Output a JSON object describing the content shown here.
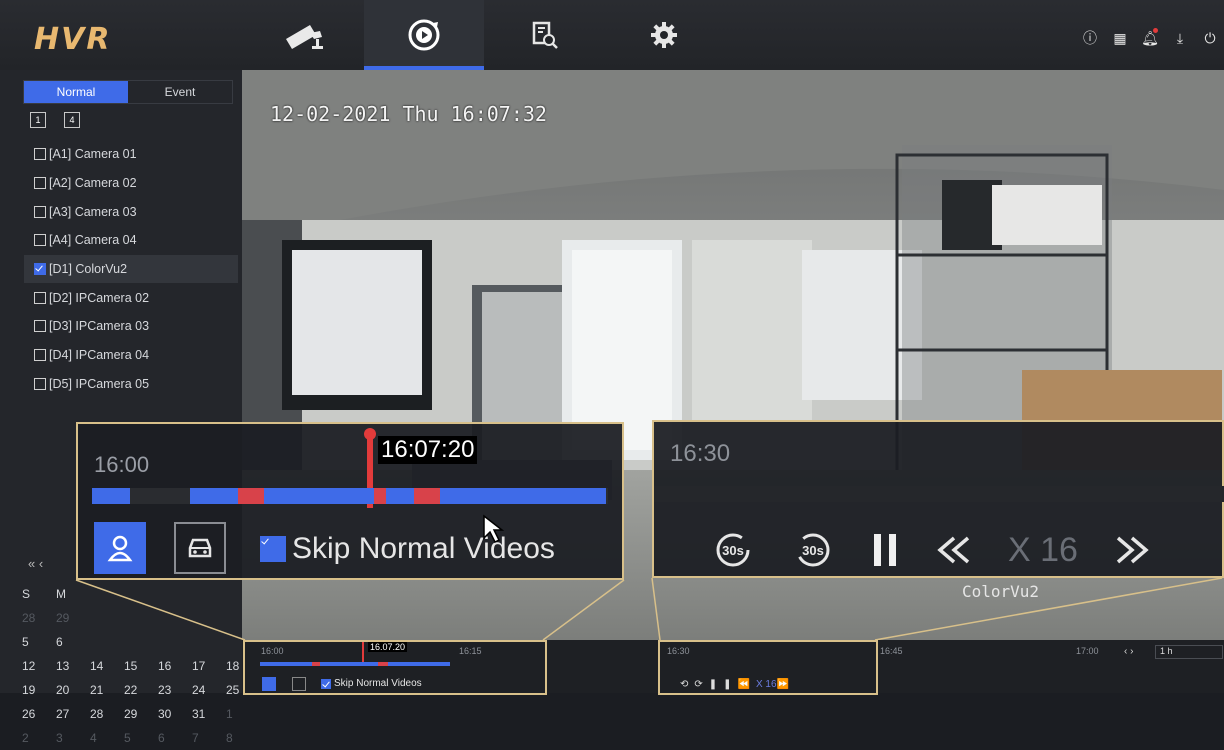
{
  "app": {
    "logo": "HVR"
  },
  "nav": {
    "tabs": [
      {
        "name": "live-view",
        "icon": "camera-icon",
        "active": false
      },
      {
        "name": "playback",
        "icon": "playback-icon",
        "active": true
      },
      {
        "name": "search",
        "icon": "file-search-icon",
        "active": false
      },
      {
        "name": "configuration",
        "icon": "gear-icon",
        "active": false
      }
    ]
  },
  "topright_icons": [
    "info-icon",
    "qr-icon",
    "bell-icon",
    "download-icon",
    "power-icon"
  ],
  "sidebar": {
    "mode_tabs": [
      "Normal",
      "Event"
    ],
    "active_mode": "Normal",
    "layouts": [
      "1",
      "4"
    ],
    "cameras": [
      {
        "label": "[A1] Camera 01",
        "checked": false
      },
      {
        "label": "[A2] Camera 02",
        "checked": false
      },
      {
        "label": "[A3] Camera 03",
        "checked": false
      },
      {
        "label": "[A4] Camera 04",
        "checked": false
      },
      {
        "label": "[D1] ColorVu2",
        "checked": true
      },
      {
        "label": "[D2] IPCamera 02",
        "checked": false
      },
      {
        "label": "[D3] IPCamera 03",
        "checked": false
      },
      {
        "label": "[D4] IPCamera 04",
        "checked": false
      },
      {
        "label": "[D5] IPCamera 05",
        "checked": false
      }
    ],
    "calendar": {
      "nav": "« ‹",
      "weekdays": [
        "S",
        "M"
      ],
      "rows": [
        [
          "28",
          "29"
        ],
        [
          "5",
          "6"
        ],
        [
          "12",
          "13",
          "14",
          "15",
          "16",
          "17",
          "18"
        ],
        [
          "19",
          "20",
          "21",
          "22",
          "23",
          "24",
          "25"
        ],
        [
          "26",
          "27",
          "28",
          "29",
          "30",
          "31",
          "1"
        ],
        [
          "2",
          "3",
          "4",
          "5",
          "6",
          "7",
          "8"
        ]
      ]
    }
  },
  "video": {
    "osd_time": "12-02-2021 Thu 16:07:32",
    "camera_name": "ColorVu2"
  },
  "timeline": {
    "ticks": [
      "16:00",
      "16:15",
      "16:30",
      "16:45",
      "17:00"
    ],
    "cursor_time": "16.07.20",
    "span": "1 h",
    "skip_label": "Skip Normal Videos",
    "speed": "X 16",
    "colors": {
      "normal": "#3f6be8",
      "event": "#d8424a",
      "cursor": "#e23b3b",
      "border": "#d8c08a"
    }
  },
  "zoom_left": {
    "time_tick": "16:00",
    "cursor_time": "16:07:20",
    "skip_label": "Skip Normal Videos"
  },
  "zoom_right": {
    "time_tick": "16:30",
    "speed": "X 16",
    "skip_back": "30s",
    "skip_fwd": "30s"
  }
}
